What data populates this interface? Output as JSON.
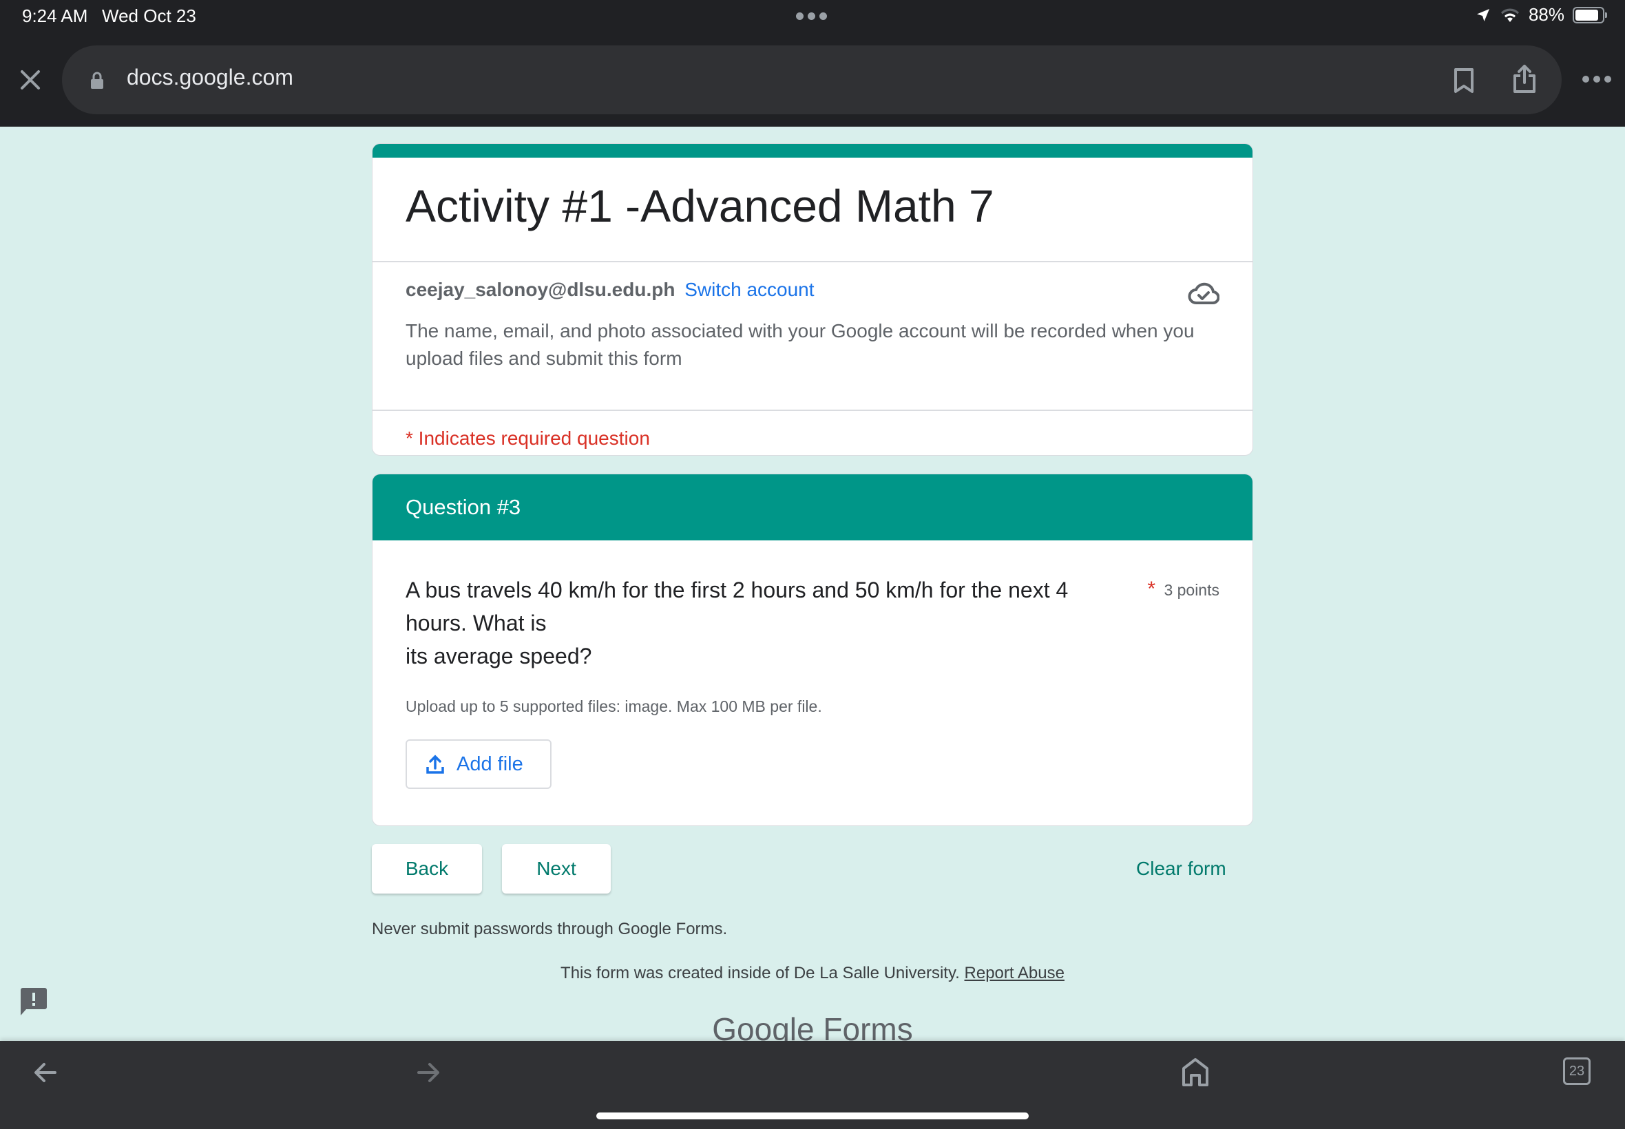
{
  "status_bar": {
    "time": "9:24 AM",
    "date": "Wed Oct 23",
    "battery": "88%",
    "battery_level": 0.88,
    "icons": [
      "location-icon",
      "wifi-icon",
      "battery-icon"
    ]
  },
  "browser": {
    "url": "docs.google.com",
    "icons": [
      "close-icon",
      "lock-icon",
      "bookmark-icon",
      "share-icon",
      "more-icon"
    ]
  },
  "form": {
    "title": "Activity #1 -Advanced Math 7",
    "email": "ceejay_salonoy@dlsu.edu.ph",
    "switch_account": "Switch account",
    "notice": "The name, email, and photo associated with your Google account will be recorded when you upload files and submit this form",
    "required_note": "* Indicates required question",
    "section_title": "Question #3",
    "question": {
      "line1": "A bus travels 40 km/h for the first 2 hours and 50 km/h for the next 4 hours. What is",
      "line2": "its average speed?",
      "required_mark": "*",
      "points": "3 points",
      "upload_hint": "Upload up to 5 supported files: image. Max 100 MB per file.",
      "add_file": "Add file"
    },
    "back_label": "Back",
    "next_label": "Next",
    "clear_label": "Clear form",
    "never_submit": "Never submit passwords through Google Forms.",
    "created_text": "This form was created inside of De La Salle University.",
    "report_abuse": "Report Abuse",
    "brand": "Google Forms"
  },
  "bottom_bar": {
    "tab_count": "23",
    "icons": [
      "back-arrow-icon",
      "forward-arrow-icon",
      "home-icon",
      "tabs-icon"
    ]
  },
  "colors": {
    "accent": "#009688",
    "background": "#d9efec",
    "link": "#1a73e8",
    "required": "#d93025"
  }
}
